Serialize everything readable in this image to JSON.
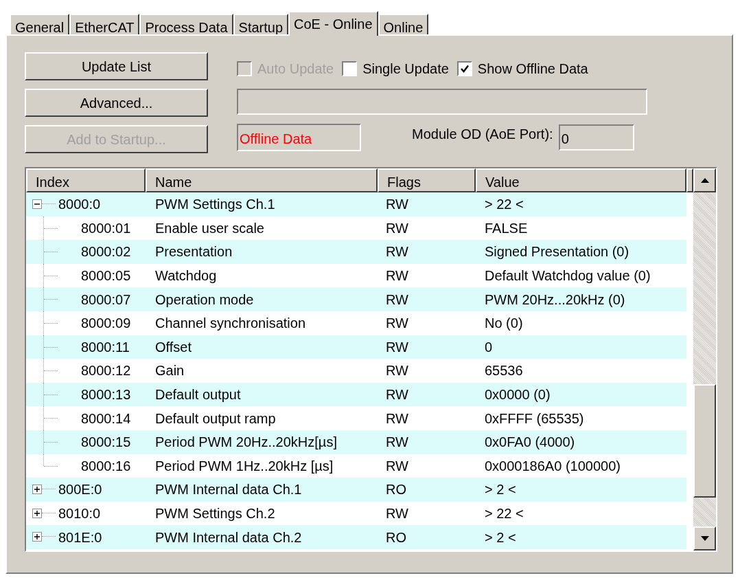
{
  "tabs": [
    {
      "label": "General",
      "selected": false
    },
    {
      "label": "EtherCAT",
      "selected": false
    },
    {
      "label": "Process Data",
      "selected": false
    },
    {
      "label": "Startup",
      "selected": false
    },
    {
      "label": "CoE - Online",
      "selected": true
    },
    {
      "label": "Online",
      "selected": false
    }
  ],
  "buttons": [
    {
      "label": "Update List",
      "disabled": false
    },
    {
      "label": "Advanced...",
      "disabled": false
    },
    {
      "label": "Add to Startup...",
      "disabled": true
    }
  ],
  "checkboxes": [
    {
      "label": "Auto Update",
      "checked": false,
      "disabled": true
    },
    {
      "label": "Single Update",
      "checked": false,
      "disabled": false
    },
    {
      "label": "Show Offline Data",
      "checked": true,
      "disabled": false
    }
  ],
  "status_field": {
    "value": "Offline Data"
  },
  "module_od": {
    "label": "Module OD (AoE Port):",
    "value": "0"
  },
  "table": {
    "columns": [
      "Index",
      "Name",
      "Flags",
      "Value"
    ],
    "rows": [
      {
        "index": "8000:0",
        "name": "PWM Settings Ch.1",
        "flags": "RW",
        "value": "> 22 <",
        "expanded": true,
        "children": [
          {
            "index": "8000:01",
            "name": "Enable user scale",
            "flags": "RW",
            "value": "FALSE"
          },
          {
            "index": "8000:02",
            "name": "Presentation",
            "flags": "RW",
            "value": "Signed Presentation (0)"
          },
          {
            "index": "8000:05",
            "name": "Watchdog",
            "flags": "RW",
            "value": "Default Watchdog value (0)"
          },
          {
            "index": "8000:07",
            "name": "Operation mode",
            "flags": "RW",
            "value": "PWM 20Hz...20kHz (0)"
          },
          {
            "index": "8000:09",
            "name": "Channel synchronisation",
            "flags": "RW",
            "value": "No (0)"
          },
          {
            "index": "8000:11",
            "name": "Offset",
            "flags": "RW",
            "value": "0"
          },
          {
            "index": "8000:12",
            "name": "Gain",
            "flags": "RW",
            "value": "65536"
          },
          {
            "index": "8000:13",
            "name": "Default output",
            "flags": "RW",
            "value": "0x0000 (0)"
          },
          {
            "index": "8000:14",
            "name": "Default output ramp",
            "flags": "RW",
            "value": "0xFFFF (65535)"
          },
          {
            "index": "8000:15",
            "name": "Period PWM 20Hz..20kHz[µs]",
            "flags": "RW",
            "value": "0x0FA0 (4000)"
          },
          {
            "index": "8000:16",
            "name": "Period PWM 1Hz..20kHz [µs]",
            "flags": "RW",
            "value": "0x000186A0 (100000)"
          }
        ]
      },
      {
        "index": "800E:0",
        "name": "PWM Internal data Ch.1",
        "flags": "RO",
        "value": "> 2 <",
        "expanded": false
      },
      {
        "index": "8010:0",
        "name": "PWM Settings Ch.2",
        "flags": "RW",
        "value": "> 22 <",
        "expanded": false
      },
      {
        "index": "801E:0",
        "name": "PWM Internal data Ch.2",
        "flags": "RO",
        "value": "> 2 <",
        "expanded": false
      }
    ]
  }
}
